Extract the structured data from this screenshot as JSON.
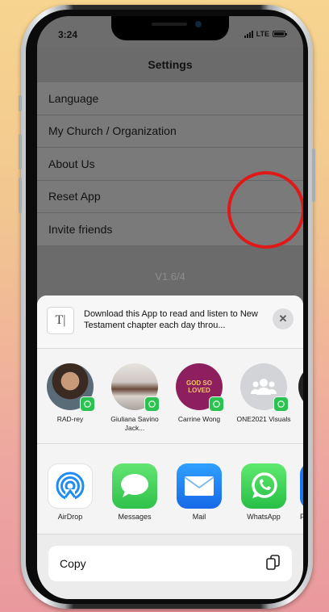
{
  "status_bar": {
    "time": "3:24",
    "network": "LTE"
  },
  "settings": {
    "title": "Settings",
    "items": [
      {
        "label": "Language"
      },
      {
        "label": "My Church / Organization"
      },
      {
        "label": "About Us"
      },
      {
        "label": "Reset App"
      },
      {
        "label": "Invite friends"
      }
    ],
    "version": "V1.6/4"
  },
  "share_sheet": {
    "preview_text": "Download this App to read and listen to New Testament chapter each day throu...",
    "contacts": [
      {
        "name": "RAD-rey"
      },
      {
        "name": "Giuliana Savino Jack..."
      },
      {
        "name": "Carrine Wong",
        "avatar_text": "GOD SO LOVED"
      },
      {
        "name": "ONE2021 Visuals"
      }
    ],
    "apps": [
      {
        "label": "AirDrop",
        "icon": "airdrop-icon"
      },
      {
        "label": "Messages",
        "icon": "messages-icon"
      },
      {
        "label": "Mail",
        "icon": "mail-icon"
      },
      {
        "label": "WhatsApp",
        "icon": "whatsapp-icon"
      },
      {
        "label": "Fa"
      }
    ],
    "copy_label": "Copy"
  },
  "colors": {
    "whatsapp_green": "#2cc251",
    "highlight_ring": "#e01818",
    "sheet_background": "#ececed"
  }
}
